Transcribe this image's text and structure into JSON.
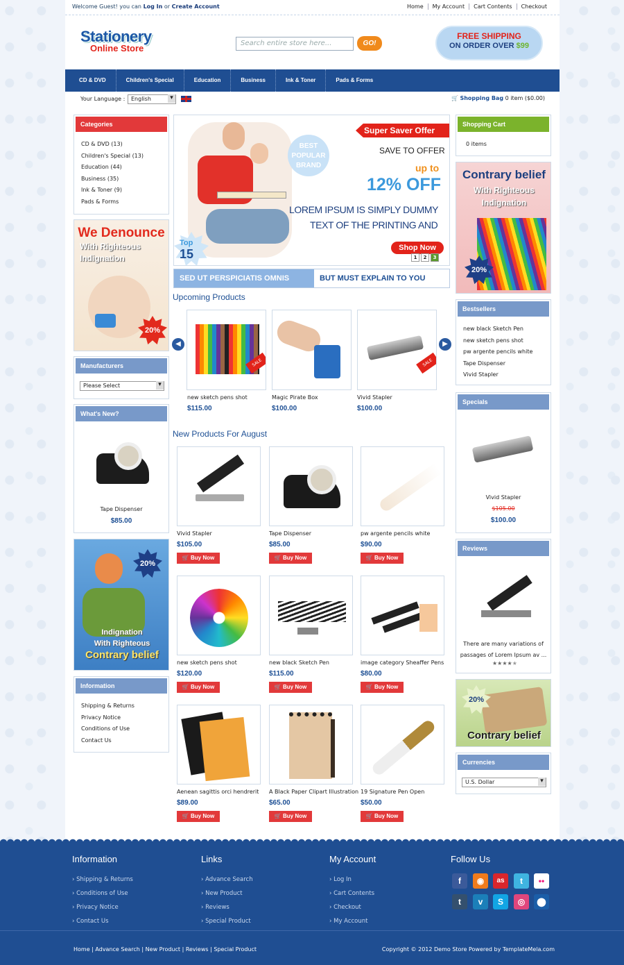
{
  "topbar": {
    "welcome_prefix": "Welcome Guest!",
    "you_can": "you can",
    "login": "Log In",
    "or": "or",
    "create_account": "Create Account",
    "links": [
      "Home",
      "My Account",
      "Cart Contents",
      "Checkout"
    ]
  },
  "logo": {
    "line1": "Stationery",
    "line2": "Online Store"
  },
  "search": {
    "placeholder": "Search entire store here...",
    "button": "GO!"
  },
  "shipping_badge": {
    "line1": "FREE SHIPPING",
    "line2": "ON ORDER OVER",
    "amount": "$99"
  },
  "nav": [
    "CD & DVD",
    "Children's Special",
    "Education",
    "Business",
    "Ink & Toner",
    "Pads & Forms"
  ],
  "language": {
    "label": "Your Language :",
    "selected": "English"
  },
  "cart_summary": {
    "label": "Shopping Bag",
    "value": "0 item ($0.00)"
  },
  "categories": {
    "title": "Categories",
    "items": [
      "CD & DVD (13)",
      "Children's Special (13)",
      "Education (44)",
      "Business (35)",
      "Ink & Toner (9)",
      "Pads & Forms"
    ]
  },
  "promo_left1": {
    "title": "We Denounce",
    "line1": "With Righteous",
    "line2": "Indignation",
    "badge": "20%"
  },
  "manufacturers": {
    "title": "Manufacturers",
    "selected": "Please Select"
  },
  "whats_new": {
    "title": "What's New?",
    "name": "Tape Dispenser",
    "price": "$85.00"
  },
  "promo_left2": {
    "line1": "Indignation",
    "line2": "With Righteous",
    "line3": "Contrary belief",
    "badge": "20%"
  },
  "information": {
    "title": "Information",
    "items": [
      "Shipping & Returns",
      "Privacy Notice",
      "Conditions of Use",
      "Contact Us"
    ]
  },
  "banner": {
    "offer": "Super Saver Offer",
    "save": "SAVE TO OFFER",
    "upto": "up to",
    "percent": "12% OFF",
    "text1": "LOREM IPSUM IS SIMPLY DUMMY",
    "text2": "TEXT OF THE PRINTING AND",
    "best1": "BEST",
    "best2": "POPULAR",
    "best3": "BRAND",
    "top": "Top",
    "top_n": "15",
    "shop": "Shop Now",
    "pages": [
      "1",
      "2",
      "3"
    ],
    "strip_left": "SED UT PERSPICIATIS OMNIS",
    "strip_right": "BUT MUST EXPLAIN TO YOU"
  },
  "upcoming": {
    "title": "Upcoming Products",
    "items": [
      {
        "name": "new sketch pens shot",
        "price": "$115.00"
      },
      {
        "name": "Magic Pirate Box",
        "price": "$100.00"
      },
      {
        "name": "Vivid Stapler",
        "price": "$100.00"
      }
    ],
    "sale": "SALE"
  },
  "new_products": {
    "title": "New Products For August",
    "buy_label": "Buy Now",
    "items": [
      {
        "name": "Vivid Stapler",
        "price": "$105.00"
      },
      {
        "name": "Tape Dispenser",
        "price": "$85.00"
      },
      {
        "name": "pw argente pencils white",
        "price": "$90.00"
      },
      {
        "name": "new sketch pens shot",
        "price": "$120.00"
      },
      {
        "name": "new black Sketch Pen",
        "price": "$115.00"
      },
      {
        "name": "image category Sheaffer Pens",
        "price": "$80.00"
      },
      {
        "name": "Aenean sagittis orci hendrerit",
        "price": "$89.00"
      },
      {
        "name": "A Black Paper Clipart Illustration",
        "price": "$65.00"
      },
      {
        "name": "19 Signature Pen Open",
        "price": "$50.00"
      }
    ]
  },
  "shopping_cart": {
    "title": "Shopping Cart",
    "text": "0 items"
  },
  "promo_right1": {
    "title": "Contrary belief",
    "line1": "With Righteous",
    "line2": "Indignation",
    "badge": "20%"
  },
  "bestsellers": {
    "title": "Bestsellers",
    "items": [
      "new black Sketch Pen",
      "new sketch pens shot",
      "pw argente pencils white",
      "Tape Dispenser",
      "Vivid Stapler"
    ]
  },
  "specials": {
    "title": "Specials",
    "name": "Vivid Stapler",
    "old_price": "$105.00",
    "price": "$100.00"
  },
  "reviews": {
    "title": "Reviews",
    "text1": "There are many variations of",
    "text2": "passages of Lorem Ipsum av ...",
    "rating": 4
  },
  "promo_right2": {
    "title": "Contrary belief",
    "badge": "20%"
  },
  "currencies": {
    "title": "Currencies",
    "selected": "U.S. Dollar"
  },
  "footer": {
    "info": {
      "title": "Information",
      "items": [
        "Shipping & Returns",
        "Conditions of Use",
        "Privacy Notice",
        "Contact Us"
      ]
    },
    "links": {
      "title": "Links",
      "items": [
        "Advance Search",
        "New Product",
        "Reviews",
        "Special Product"
      ]
    },
    "account": {
      "title": "My Account",
      "items": [
        "Log In",
        "Cart Contents",
        "Checkout",
        "My Account"
      ]
    },
    "follow": {
      "title": "Follow Us"
    },
    "bottom_links": [
      "Home",
      "Advance Search",
      "New Product",
      "Reviews",
      "Special Product"
    ],
    "copyright": "Copyright © 2012 Demo Store Powered by TemplateMela.com"
  },
  "colors": {
    "primary": "#1f4e92",
    "accent_red": "#e2393a",
    "accent_green": "#7bb32c",
    "price_blue": "#1d4f94"
  }
}
